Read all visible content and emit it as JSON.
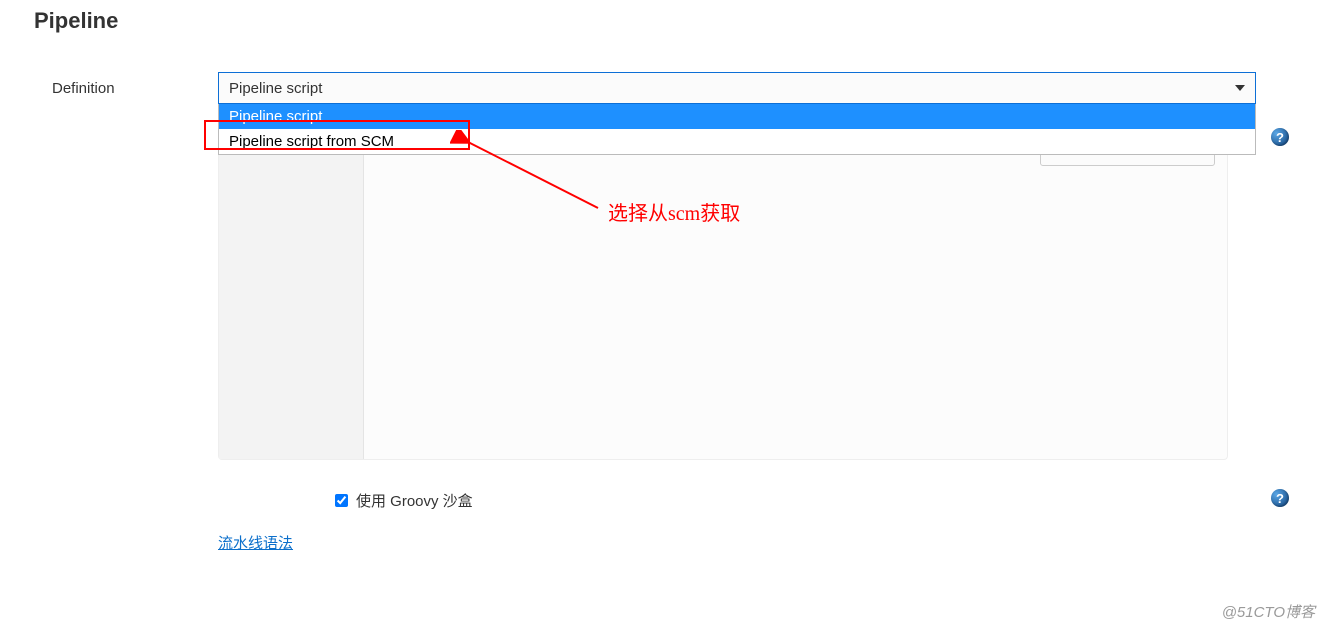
{
  "section": {
    "title": "Pipeline"
  },
  "form": {
    "definition_label": "Definition",
    "select_value": "Pipeline script",
    "options": {
      "opt1": "Pipeline script",
      "opt2": "Pipeline script from SCM"
    }
  },
  "annotation": {
    "text": "选择从scm获取"
  },
  "checkbox": {
    "label": "使用 Groovy 沙盒",
    "checked": true
  },
  "link": {
    "syntax": "流水线语法"
  },
  "help": {
    "glyph": "?"
  },
  "watermark": {
    "text": "@51CTO博客"
  }
}
